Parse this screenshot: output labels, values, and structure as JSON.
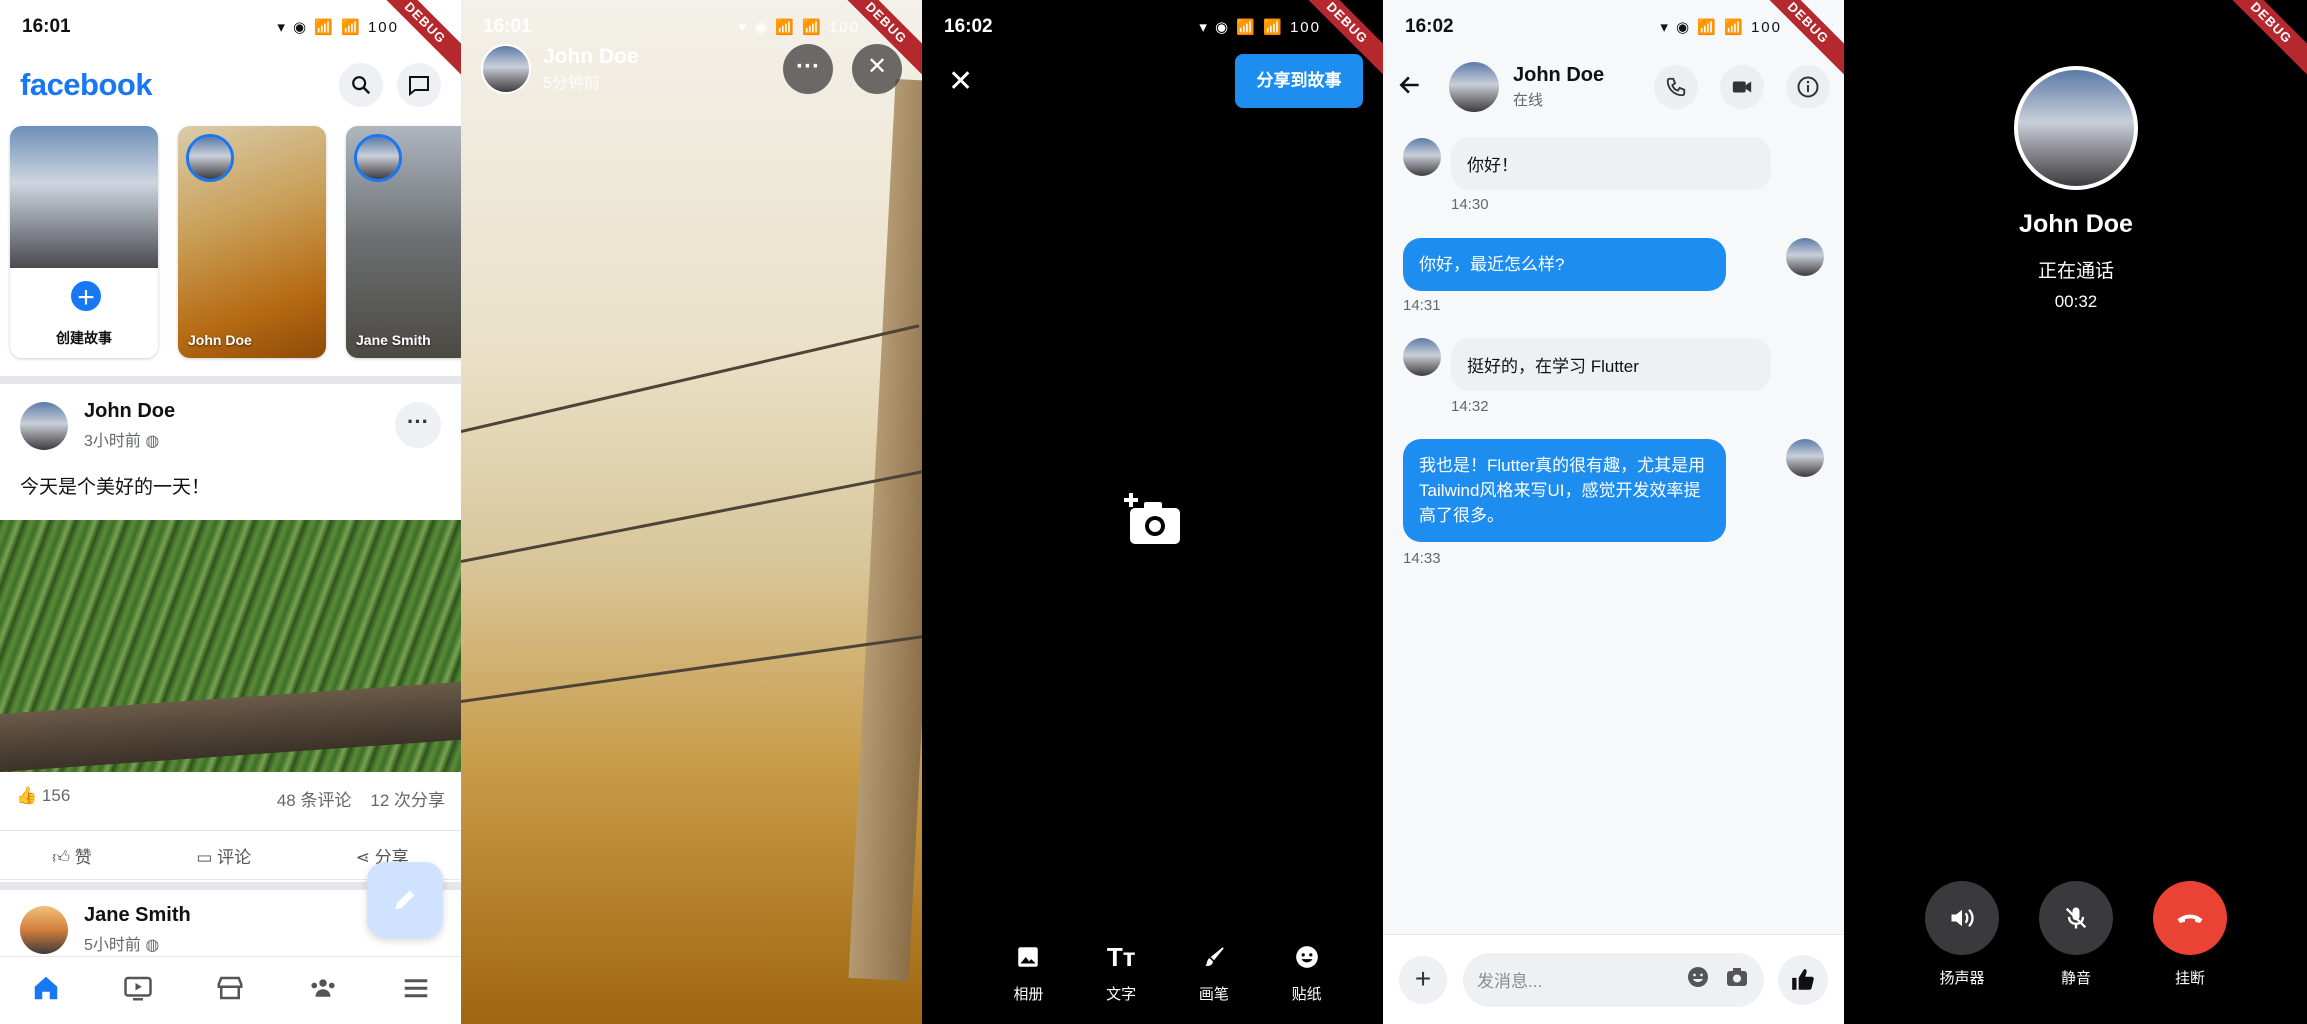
{
  "debug_label": "DEBUG",
  "screen1": {
    "time": "16:01",
    "status_icons": "▾ ◉ 📶 📶 100",
    "logo": "facebook",
    "stories": [
      {
        "label": "创建故事"
      },
      {
        "name": "John Doe"
      },
      {
        "name": "Jane Smith"
      }
    ],
    "post": {
      "author": "John Doe",
      "time": "3小时前",
      "text": "今天是个美好的一天！",
      "likes": "156",
      "comments": "48 条评论",
      "shares": "12 次分享",
      "actions": {
        "like": "赞",
        "comment": "评论",
        "share": "分享"
      }
    },
    "post2": {
      "author": "Jane Smith",
      "time": "5小时前"
    }
  },
  "screen2": {
    "time": "16:01",
    "name": "John Doe",
    "time_ago": "5分钟前"
  },
  "screen3": {
    "time": "16:02",
    "share_label": "分享到故事",
    "tools": [
      {
        "icon": "image-icon",
        "label": "相册"
      },
      {
        "icon": "text-icon",
        "label": "文字"
      },
      {
        "icon": "brush-icon",
        "label": "画笔"
      },
      {
        "icon": "sticker-icon",
        "label": "贴纸"
      }
    ]
  },
  "screen4": {
    "time": "16:02",
    "contact": "John Doe",
    "presence": "在线",
    "messages": [
      {
        "dir": "in",
        "text": "你好！",
        "time": "14:30"
      },
      {
        "dir": "out",
        "text": "你好，最近怎么样?",
        "time": "14:31"
      },
      {
        "dir": "in",
        "text": "挺好的，在学习 Flutter",
        "time": "14:32"
      },
      {
        "dir": "out",
        "text": "我也是！Flutter真的很有趣，尤其是用Tailwind风格来写UI，感觉开发效率提高了很多。",
        "time": "14:33"
      }
    ],
    "input_placeholder": "发消息..."
  },
  "screen5": {
    "name": "John Doe",
    "status": "正在通话",
    "duration": "00:32",
    "controls": {
      "speaker": "扬声器",
      "mute": "静音",
      "hangup": "挂断"
    }
  },
  "colors": {
    "brand": "#1877f2",
    "bubble_out": "#1d8df0",
    "hangup": "#ea4335"
  }
}
